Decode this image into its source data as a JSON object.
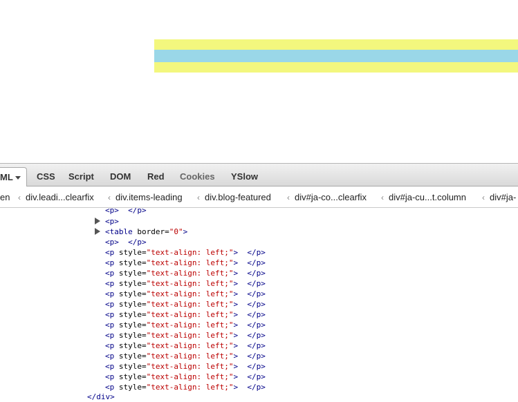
{
  "tabs": [
    "ML",
    "CSS",
    "Script",
    "DOM",
    "Red",
    "Cookies",
    "YSlow"
  ],
  "breadcrumbs": [
    "en",
    "div.leadi...clearfix",
    "div.items-leading",
    "div.blog-featured",
    "div#ja-co...clearfix",
    "div#ja-cu...t.column",
    "div#ja-"
  ],
  "tree": {
    "truncated_top": "<p>  </p>",
    "collapsed_p": "<p>",
    "table_open": "<table",
    "table_attr": "border",
    "table_val": "\"0\"",
    "table_close": ">",
    "empty_p": "<p>  </p>",
    "p_open": "<p",
    "p_attr": "style",
    "p_val": "\"text-align: left;\"",
    "p_close": ">  </p>",
    "div_close": "</div>"
  },
  "colors": {
    "highlight_yellow": "#f3f77e",
    "highlight_blue": "#9ad7e8",
    "tag_blue": "#000088",
    "value_red": "#bb0000"
  }
}
